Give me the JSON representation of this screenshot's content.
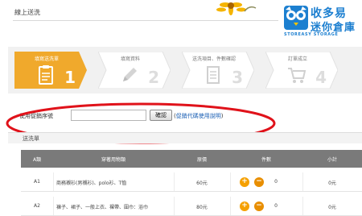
{
  "page": {
    "title": "線上送洗"
  },
  "logo": {
    "line1": "收多易",
    "line2": "迷你倉庫",
    "english": "STOREASY STORAGE"
  },
  "steps": [
    {
      "label": "填寫送洗單",
      "number": "1",
      "icon": "clipboard-icon",
      "active": true
    },
    {
      "label": "填寫資料",
      "number": "2",
      "icon": "pencil-icon",
      "active": false
    },
    {
      "label": "送洗項目、件數確認",
      "number": "3",
      "icon": "document-icon",
      "active": false
    },
    {
      "label": "訂單成立",
      "number": "4",
      "icon": "cart-icon",
      "active": false
    }
  ],
  "promo": {
    "label": "使用促銷序號",
    "input_value": "",
    "confirm_label": "確認",
    "help_prefix": "(",
    "help_link": "促銷代碼使用說明",
    "help_suffix": ")"
  },
  "order": {
    "header": "送洗單"
  },
  "table": {
    "columns": [
      "A類",
      "穿著用物類",
      "原價",
      "件數",
      "小計"
    ],
    "rows": [
      {
        "code": "A1",
        "item": "商務襯衫(男襯衫)、polo衫、T恤",
        "price": "60元",
        "qty": "0",
        "subtotal": "0元"
      },
      {
        "code": "A2",
        "item": "褲子、裙子、一般上衣、裸帶、圍巾：浴巾",
        "price": "80元",
        "qty": "0",
        "subtotal": "0元"
      }
    ]
  },
  "colors": {
    "accent": "#f0a92c",
    "highlight_ring": "#e0121a",
    "table_header": "#7a7a7a"
  }
}
